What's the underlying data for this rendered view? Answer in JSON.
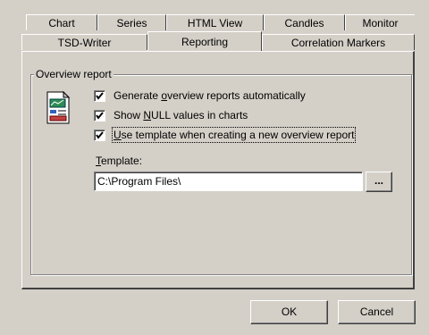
{
  "tabs_row1": [
    {
      "label": "Chart"
    },
    {
      "label": "Series"
    },
    {
      "label": "HTML View"
    },
    {
      "label": "Candles"
    },
    {
      "label": "Monitor"
    }
  ],
  "tabs_row2": [
    {
      "label": "TSD-Writer"
    },
    {
      "label": "Reporting",
      "active": true
    },
    {
      "label": "Correlation Markers"
    }
  ],
  "group": {
    "title": "Overview report",
    "icon": "report-document-icon"
  },
  "options": {
    "generate_pre": "Generate ",
    "generate_u": "o",
    "generate_post": "verview reports automatically",
    "generate_checked": true,
    "null_pre": "Show ",
    "null_u": "N",
    "null_post": "ULL values in charts",
    "null_checked": true,
    "template_pre": "",
    "template_u": "U",
    "template_post": "se template when creating a new overview report",
    "template_checked": true
  },
  "template": {
    "label_u": "T",
    "label_rest": "emplate:",
    "value": "C:\\Program Files\\",
    "browse_label": "..."
  },
  "buttons": {
    "ok": "OK",
    "cancel": "Cancel"
  }
}
